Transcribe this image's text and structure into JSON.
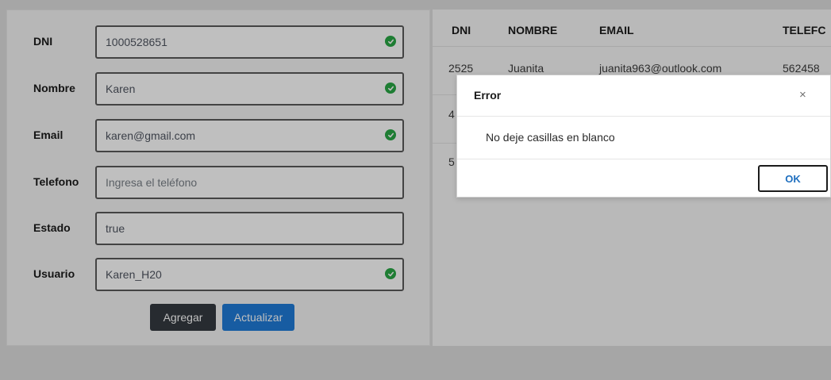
{
  "form": {
    "fields": [
      {
        "label": "DNI",
        "value": "1000528651",
        "placeholder": "",
        "valid": true
      },
      {
        "label": "Nombre",
        "value": "Karen",
        "placeholder": "",
        "valid": true
      },
      {
        "label": "Email",
        "value": "karen@gmail.com",
        "placeholder": "",
        "valid": true
      },
      {
        "label": "Telefono",
        "value": "",
        "placeholder": "Ingresa el teléfono",
        "valid": false
      },
      {
        "label": "Estado",
        "value": "true",
        "placeholder": "",
        "valid": false
      },
      {
        "label": "Usuario",
        "value": "Karen_H20",
        "placeholder": "",
        "valid": true
      }
    ],
    "add_label": "Agregar",
    "update_label": "Actualizar"
  },
  "table": {
    "headers": [
      "DNI",
      "NOMBRE",
      "EMAIL",
      "TELEFC"
    ],
    "rows": [
      {
        "dni": "2525",
        "nombre": "Juanita",
        "email": "juanita963@outlook.com",
        "telefono": "562458"
      },
      {
        "dni": "4",
        "nombre": "",
        "email": "",
        "telefono": ""
      },
      {
        "dni": "5",
        "nombre": "",
        "email": "",
        "telefono": ""
      }
    ]
  },
  "modal": {
    "title": "Error",
    "close_glyph": "×",
    "message": "No deje casillas en blanco",
    "ok_label": "OK"
  },
  "colors": {
    "valid_check": "#28a745",
    "primary_button": "#1f7bd8",
    "dark_button": "#343a40"
  },
  "icons": {
    "valid": "check-circle-icon",
    "close": "close-icon"
  }
}
